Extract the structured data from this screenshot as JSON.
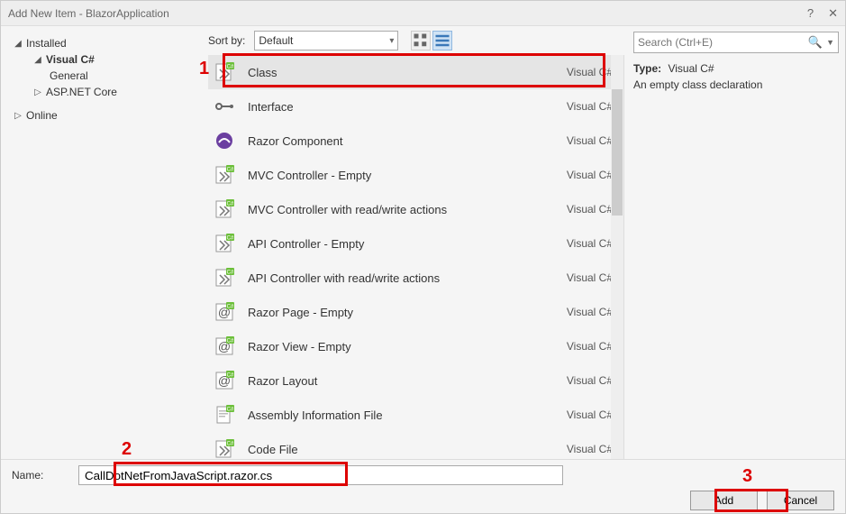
{
  "window": {
    "title": "Add New Item - BlazorApplication"
  },
  "sidebar": {
    "installed": "Installed",
    "visual_cs": "Visual C#",
    "general": "General",
    "aspnet": "ASP.NET Core",
    "online": "Online"
  },
  "toolbar": {
    "sort_label": "Sort by:",
    "sort_value": "Default"
  },
  "templates": [
    {
      "name": "Class",
      "lang": "Visual C#",
      "icon": "class",
      "selected": true
    },
    {
      "name": "Interface",
      "lang": "Visual C#",
      "icon": "interface",
      "selected": false
    },
    {
      "name": "Razor Component",
      "lang": "Visual C#",
      "icon": "razor-comp",
      "selected": false
    },
    {
      "name": "MVC Controller - Empty",
      "lang": "Visual C#",
      "icon": "class",
      "selected": false
    },
    {
      "name": "MVC Controller with read/write actions",
      "lang": "Visual C#",
      "icon": "class",
      "selected": false
    },
    {
      "name": "API Controller - Empty",
      "lang": "Visual C#",
      "icon": "class",
      "selected": false
    },
    {
      "name": "API Controller with read/write actions",
      "lang": "Visual C#",
      "icon": "class",
      "selected": false
    },
    {
      "name": "Razor Page - Empty",
      "lang": "Visual C#",
      "icon": "razor-at",
      "selected": false
    },
    {
      "name": "Razor View - Empty",
      "lang": "Visual C#",
      "icon": "razor-at",
      "selected": false
    },
    {
      "name": "Razor Layout",
      "lang": "Visual C#",
      "icon": "razor-at",
      "selected": false
    },
    {
      "name": "Assembly Information File",
      "lang": "Visual C#",
      "icon": "file",
      "selected": false
    },
    {
      "name": "Code File",
      "lang": "Visual C#",
      "icon": "class",
      "selected": false
    }
  ],
  "search": {
    "placeholder": "Search (Ctrl+E)"
  },
  "detail": {
    "type_label": "Type:",
    "type_value": "Visual C#",
    "description": "An empty class declaration"
  },
  "name_field": {
    "label": "Name:",
    "value": "CallDotNetFromJavaScript.razor.cs"
  },
  "buttons": {
    "add": "Add",
    "cancel": "Cancel"
  },
  "annotations": {
    "one": "1",
    "two": "2",
    "three": "3"
  }
}
